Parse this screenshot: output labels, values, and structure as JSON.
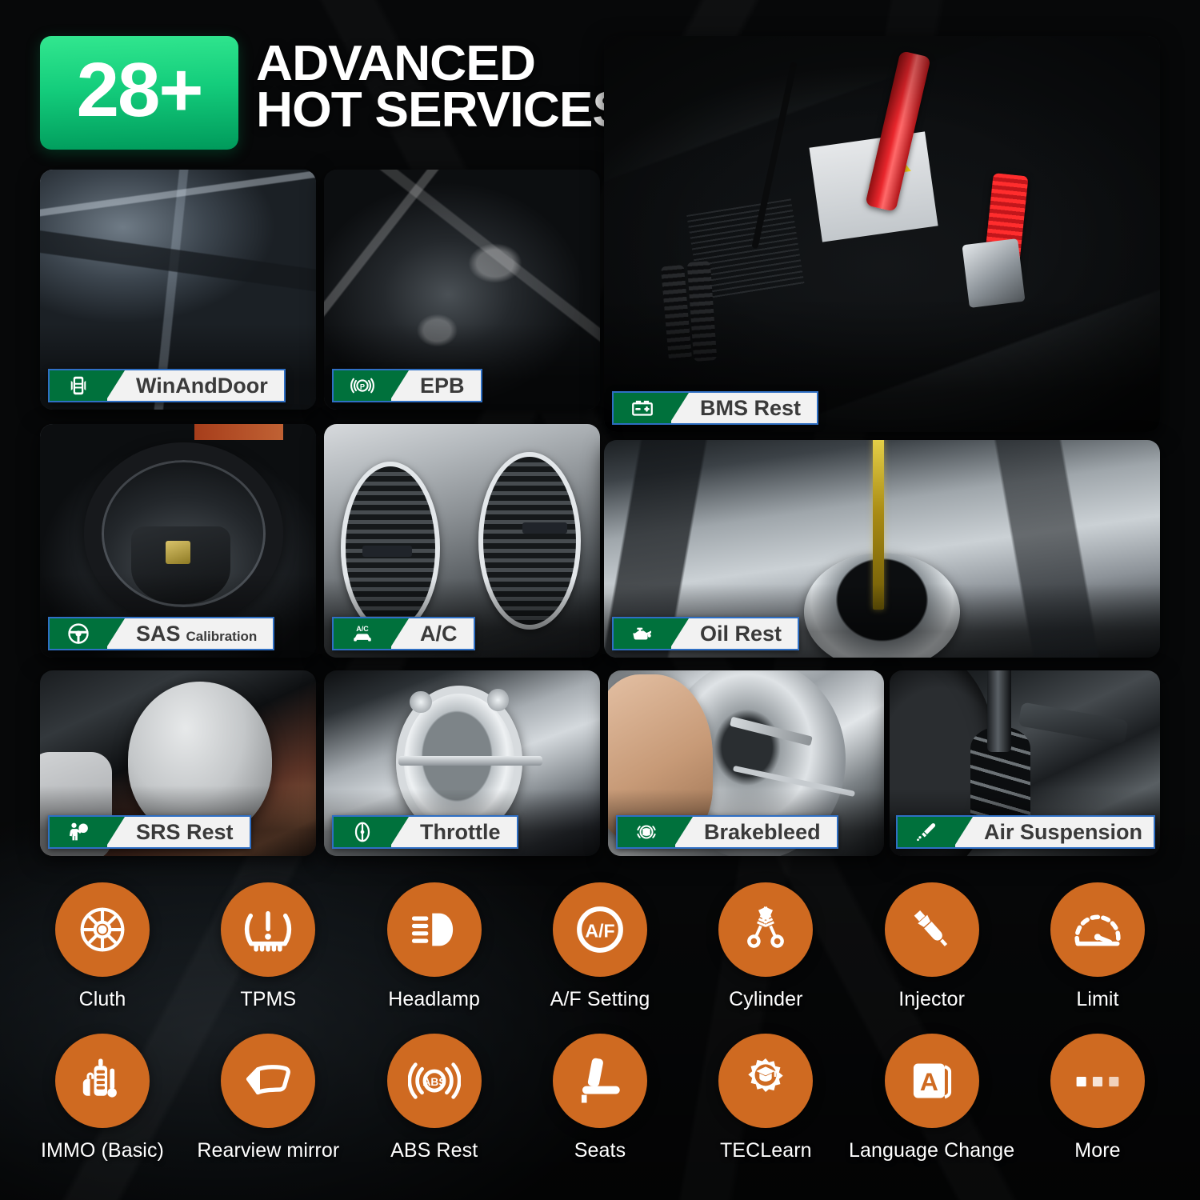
{
  "header": {
    "badge_count": "28+",
    "line1": "ADVANCED",
    "line2": "HOT SERVICES",
    "badge_gradient_from": "#32e78f",
    "badge_gradient_to": "#009a5b"
  },
  "theme": {
    "chip_green": "#00713c",
    "chip_border_blue": "#2f6fc4",
    "chip_white": "#f2f2f2",
    "chip_text": "#3a3a3a",
    "orange": "#cf6a21",
    "background": "#050505"
  },
  "service_cards": [
    {
      "label": "WinAndDoor",
      "sub": "",
      "icon": "car-top-view-icon"
    },
    {
      "label": "EPB",
      "sub": "",
      "icon": "parking-brake-icon"
    },
    {
      "label": "BMS Rest",
      "sub": "",
      "icon": "battery-icon"
    },
    {
      "label": "SAS",
      "sub": "Calibration",
      "icon": "steering-wheel-icon"
    },
    {
      "label": "A/C",
      "sub": "",
      "icon": "ac-car-icon"
    },
    {
      "label": "Oil Rest",
      "sub": "",
      "icon": "oil-can-icon"
    },
    {
      "label": "SRS Rest",
      "sub": "",
      "icon": "airbag-icon"
    },
    {
      "label": "Throttle",
      "sub": "",
      "icon": "throttle-icon"
    },
    {
      "label": "Brakebleed",
      "sub": "",
      "icon": "brake-disc-icon"
    },
    {
      "label": "Air Suspension",
      "sub": "",
      "icon": "air-suspension-icon"
    }
  ],
  "function_icons_row1": [
    {
      "label": "Cluth",
      "icon": "clutch-icon"
    },
    {
      "label": "TPMS",
      "icon": "tire-pressure-icon"
    },
    {
      "label": "Headlamp",
      "icon": "headlamp-icon"
    },
    {
      "label": "A/F Setting",
      "icon": "air-fuel-icon"
    },
    {
      "label": "Cylinder",
      "icon": "piston-icon"
    },
    {
      "label": "Injector",
      "icon": "injector-icon"
    },
    {
      "label": "Limit",
      "icon": "gauge-icon"
    }
  ],
  "function_icons_row2": [
    {
      "label": "IMMO (Basic)",
      "icon": "immobilizer-key-icon"
    },
    {
      "label": "Rearview mirror",
      "icon": "mirror-icon"
    },
    {
      "label": "ABS Rest",
      "icon": "abs-icon"
    },
    {
      "label": "Seats",
      "icon": "seat-icon"
    },
    {
      "label": "TECLearn",
      "icon": "gear-graduation-icon"
    },
    {
      "label": "Language Change",
      "icon": "language-a-icon"
    },
    {
      "label": "More",
      "icon": "ellipsis-icon"
    }
  ]
}
